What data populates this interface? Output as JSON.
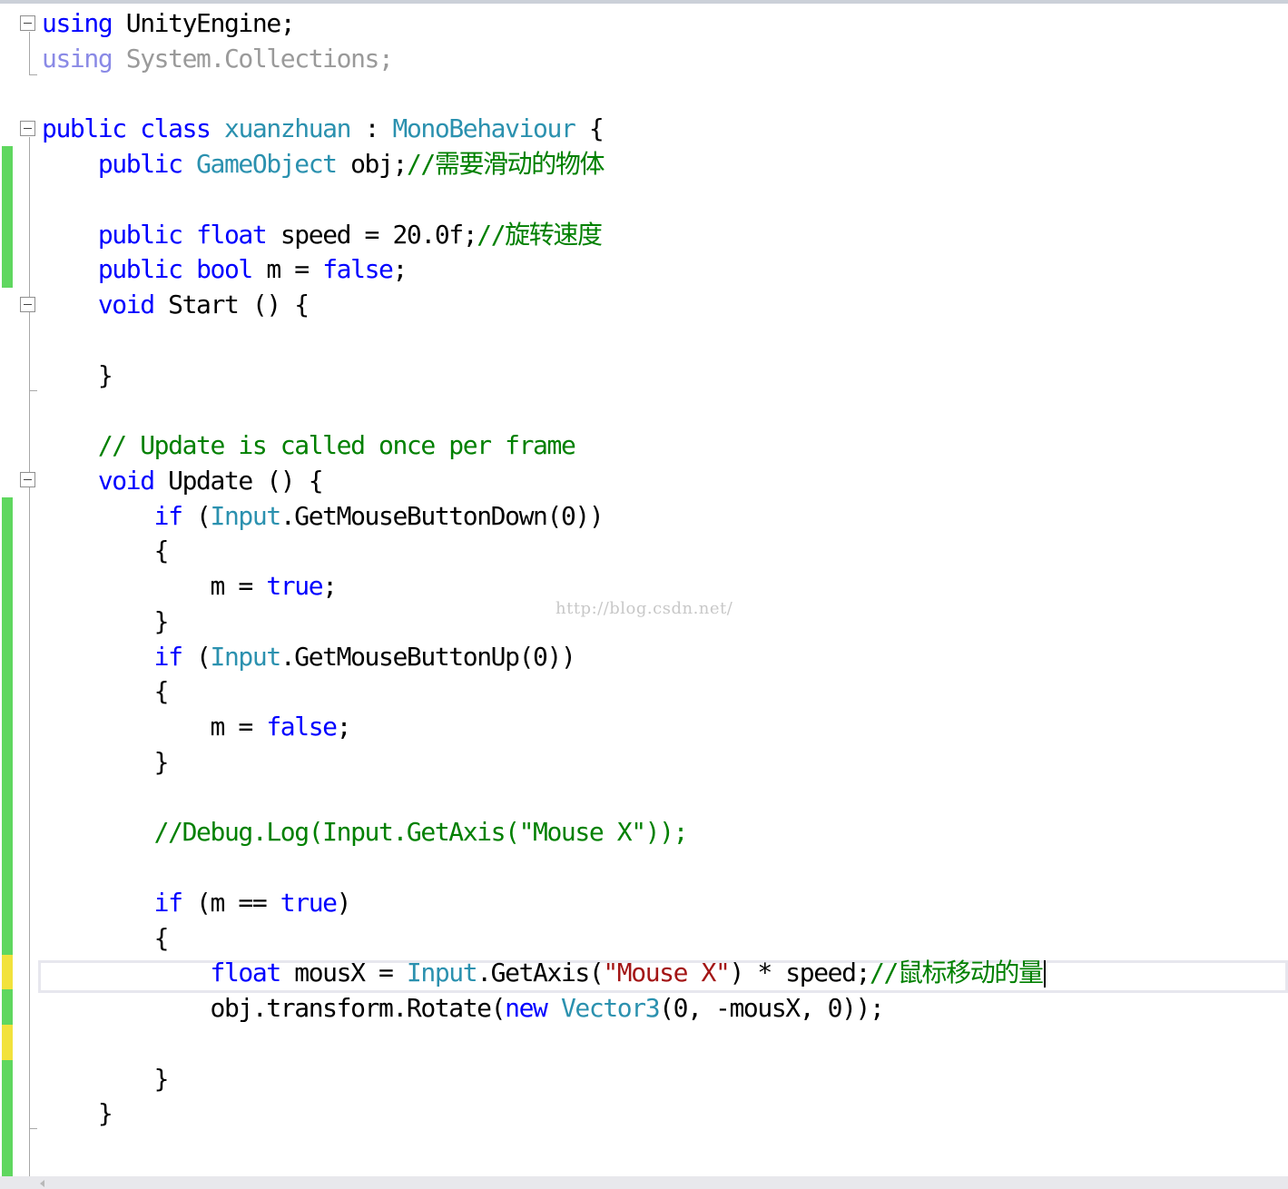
{
  "editor": {
    "lines": [
      {
        "segments": [
          {
            "t": "using",
            "c": "kw"
          },
          {
            "t": " UnityEngine;"
          }
        ]
      },
      {
        "segments": [
          {
            "t": "using",
            "c": "kw"
          },
          {
            "t": " System.Collections;"
          }
        ],
        "dim": true
      },
      {
        "segments": []
      },
      {
        "segments": [
          {
            "t": "public",
            "c": "kw"
          },
          {
            "t": " "
          },
          {
            "t": "class",
            "c": "kw"
          },
          {
            "t": " "
          },
          {
            "t": "xuanzhuan",
            "c": "ty"
          },
          {
            "t": " : "
          },
          {
            "t": "MonoBehaviour",
            "c": "ty"
          },
          {
            "t": " {"
          }
        ]
      },
      {
        "segments": [
          {
            "t": "    "
          },
          {
            "t": "public",
            "c": "kw"
          },
          {
            "t": " "
          },
          {
            "t": "GameObject",
            "c": "ty"
          },
          {
            "t": " obj;"
          },
          {
            "t": "//需要滑动的物体",
            "c": "cm"
          }
        ]
      },
      {
        "segments": []
      },
      {
        "segments": [
          {
            "t": "    "
          },
          {
            "t": "public",
            "c": "kw"
          },
          {
            "t": " "
          },
          {
            "t": "float",
            "c": "kw"
          },
          {
            "t": " speed = 20.0f;"
          },
          {
            "t": "//旋转速度",
            "c": "cm"
          }
        ]
      },
      {
        "segments": [
          {
            "t": "    "
          },
          {
            "t": "public",
            "c": "kw"
          },
          {
            "t": " "
          },
          {
            "t": "bool",
            "c": "kw"
          },
          {
            "t": " m = "
          },
          {
            "t": "false",
            "c": "kw"
          },
          {
            "t": ";"
          }
        ]
      },
      {
        "segments": [
          {
            "t": "    "
          },
          {
            "t": "void",
            "c": "kw"
          },
          {
            "t": " Start () {"
          }
        ]
      },
      {
        "segments": []
      },
      {
        "segments": [
          {
            "t": "    }"
          }
        ]
      },
      {
        "segments": []
      },
      {
        "segments": [
          {
            "t": "    "
          },
          {
            "t": "// Update is called once per frame",
            "c": "cm"
          }
        ]
      },
      {
        "segments": [
          {
            "t": "    "
          },
          {
            "t": "void",
            "c": "kw"
          },
          {
            "t": " Update () {"
          }
        ]
      },
      {
        "segments": [
          {
            "t": "        "
          },
          {
            "t": "if",
            "c": "kw"
          },
          {
            "t": " ("
          },
          {
            "t": "Input",
            "c": "ty"
          },
          {
            "t": ".GetMouseButtonDown(0))"
          }
        ]
      },
      {
        "segments": [
          {
            "t": "        {"
          }
        ]
      },
      {
        "segments": [
          {
            "t": "            m = "
          },
          {
            "t": "true",
            "c": "kw"
          },
          {
            "t": ";"
          }
        ]
      },
      {
        "segments": [
          {
            "t": "        }"
          }
        ]
      },
      {
        "segments": [
          {
            "t": "        "
          },
          {
            "t": "if",
            "c": "kw"
          },
          {
            "t": " ("
          },
          {
            "t": "Input",
            "c": "ty"
          },
          {
            "t": ".GetMouseButtonUp(0))"
          }
        ]
      },
      {
        "segments": [
          {
            "t": "        {"
          }
        ]
      },
      {
        "segments": [
          {
            "t": "            m = "
          },
          {
            "t": "false",
            "c": "kw"
          },
          {
            "t": ";"
          }
        ]
      },
      {
        "segments": [
          {
            "t": "        }"
          }
        ]
      },
      {
        "segments": []
      },
      {
        "segments": [
          {
            "t": "        "
          },
          {
            "t": "//Debug.Log(Input.GetAxis(\"Mouse X\"));",
            "c": "cm"
          }
        ]
      },
      {
        "segments": []
      },
      {
        "segments": [
          {
            "t": "        "
          },
          {
            "t": "if",
            "c": "kw"
          },
          {
            "t": " (m == "
          },
          {
            "t": "true",
            "c": "kw"
          },
          {
            "t": ")"
          }
        ]
      },
      {
        "segments": [
          {
            "t": "        {"
          }
        ]
      },
      {
        "segments": [
          {
            "t": "            "
          },
          {
            "t": "float",
            "c": "kw"
          },
          {
            "t": " mousX = "
          },
          {
            "t": "Input",
            "c": "ty"
          },
          {
            "t": ".GetAxis("
          },
          {
            "t": "\"Mouse X\"",
            "c": "st"
          },
          {
            "t": ") * speed;"
          },
          {
            "t": "//鼠标移动的量",
            "c": "cm"
          }
        ],
        "caret": true
      },
      {
        "segments": [
          {
            "t": "            obj.transform.Rotate("
          },
          {
            "t": "new",
            "c": "kw"
          },
          {
            "t": " "
          },
          {
            "t": "Vector3",
            "c": "ty"
          },
          {
            "t": "(0, -mousX, 0));"
          }
        ]
      },
      {
        "segments": []
      },
      {
        "segments": [
          {
            "t": "        }"
          }
        ]
      },
      {
        "segments": [
          {
            "t": "    }"
          }
        ]
      }
    ]
  },
  "watermark": "http://blog.csdn.net/"
}
